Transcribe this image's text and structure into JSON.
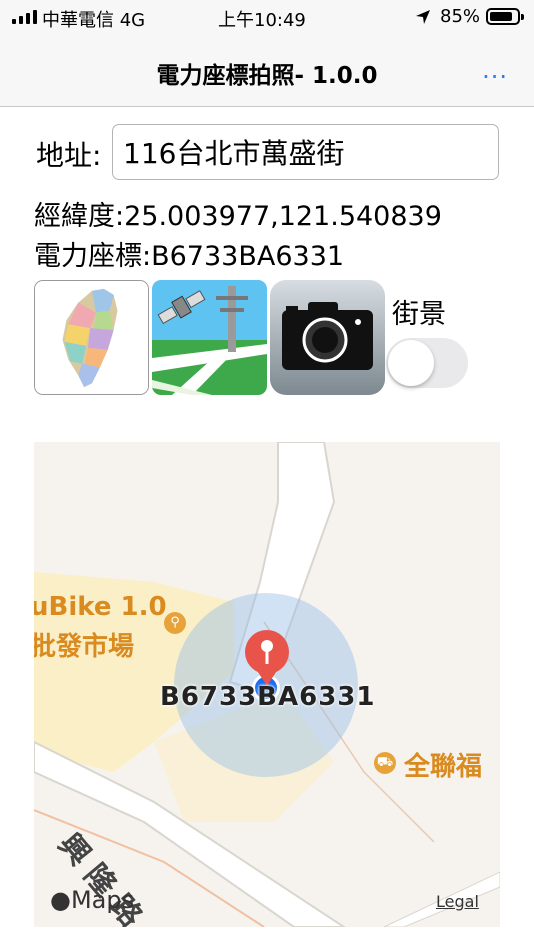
{
  "status_bar": {
    "carrier": "中華電信  4G",
    "time": "上午10:49",
    "battery_percent": "85%",
    "battery_level": 0.85
  },
  "nav": {
    "title": "電力座標拍照- 1.0.0",
    "more_label": "..."
  },
  "form": {
    "address_label": "地址:",
    "address_value": "116台北市萬盛街",
    "coord_label": "經緯度:",
    "coord_value": "25.003977,121.540839",
    "pole_label": "電力座標:",
    "pole_value": "B6733BA6331"
  },
  "buttons": {
    "taiwan_map_icon": "taiwan-map-icon",
    "gps_pole_icon": "satellite-pole-icon",
    "camera_icon": "camera-icon"
  },
  "street_view": {
    "label": "街景",
    "enabled": false
  },
  "map": {
    "poi_ubike": "uBike 1.0",
    "poi_market": "批發市場",
    "poi_store": "全聯福",
    "road_label": "興隆路一",
    "marker_label": "B6733BA6331",
    "maps_brand": "Maps",
    "legal_link": "Legal",
    "colors": {
      "accuracy": "#96bee6",
      "location_dot": "#1b6ef3",
      "pin": "#e8534a",
      "poi": "#d98b1f"
    }
  }
}
